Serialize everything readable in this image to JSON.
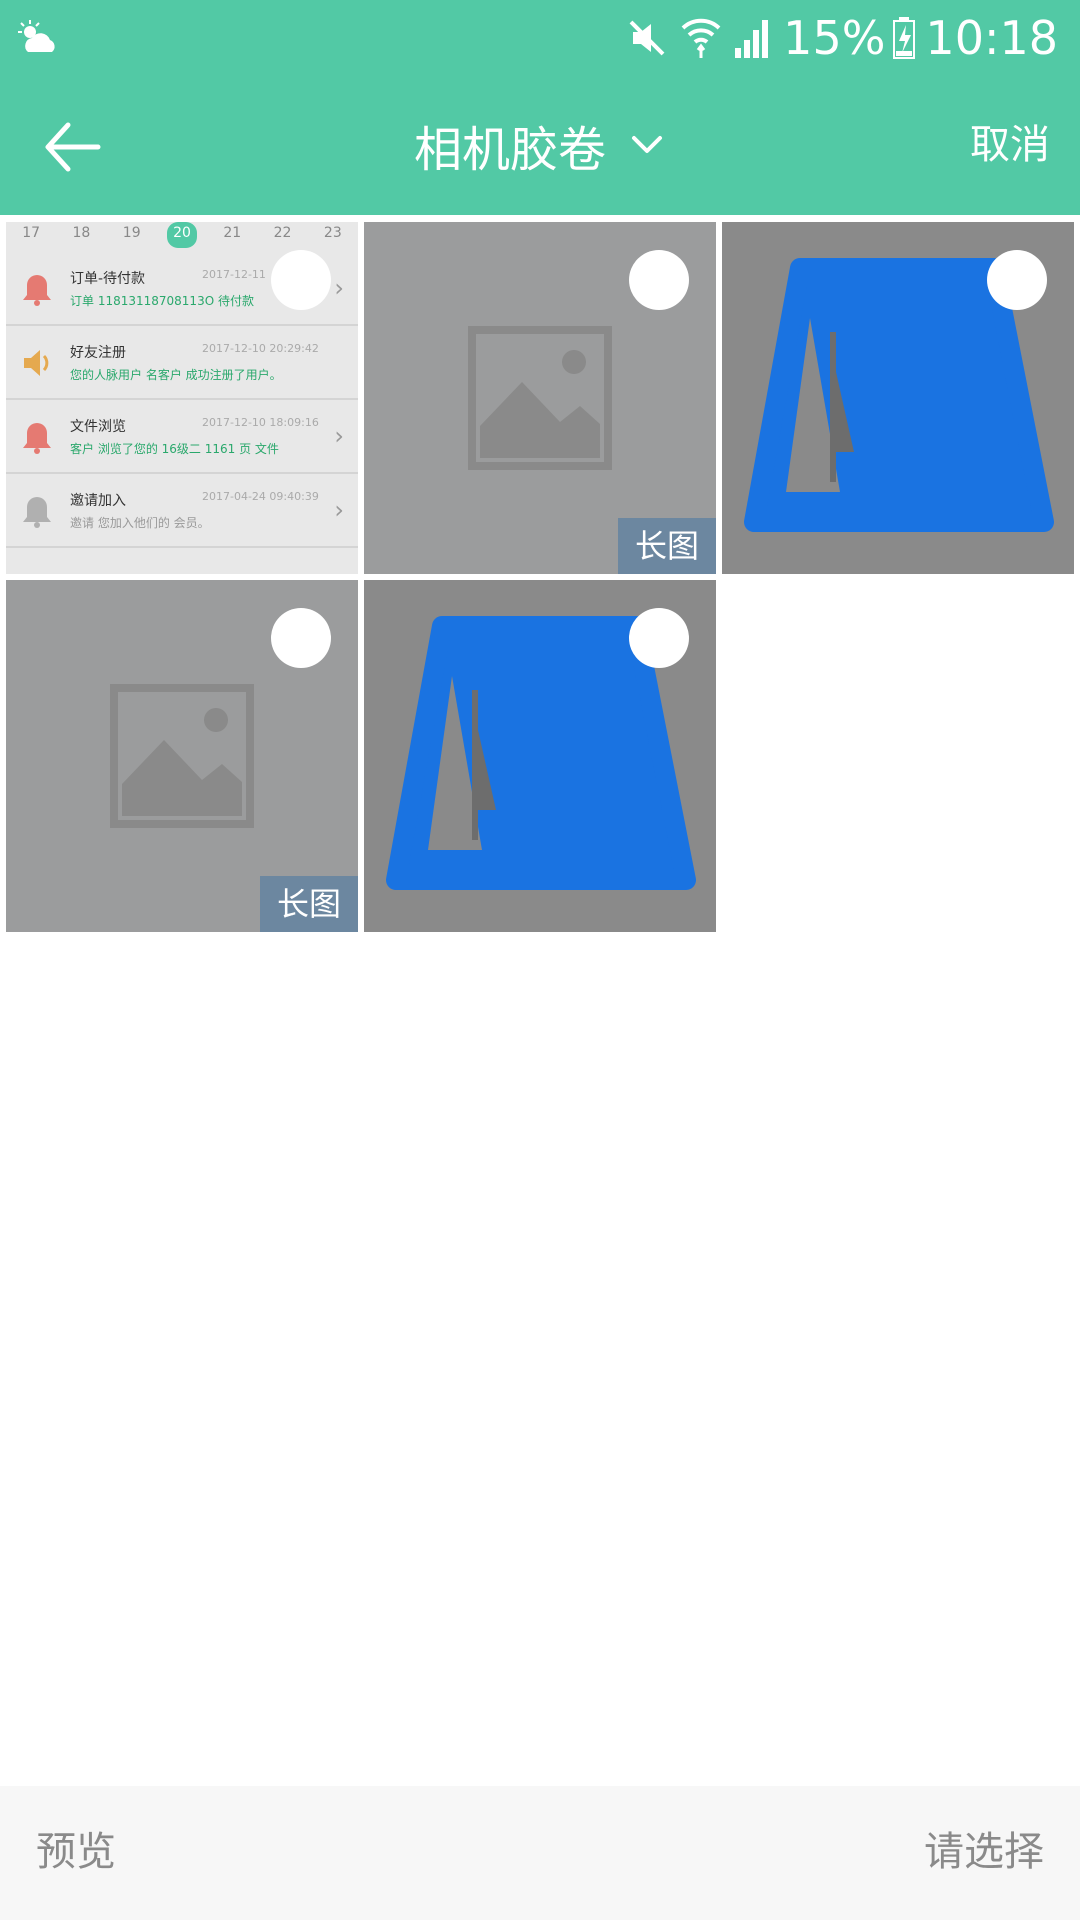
{
  "status_bar": {
    "battery": "15%",
    "time": "10:18",
    "icons": [
      "weather-icon",
      "mute-icon",
      "wifi-icon",
      "signal-icon",
      "battery-charging-icon"
    ]
  },
  "app_bar": {
    "title": "相机胶卷",
    "cancel_label": "取消",
    "accent_color": "#52c9a5"
  },
  "grid": {
    "photos": [
      {
        "kind": "notification-screenshot",
        "tag": ""
      },
      {
        "kind": "image-placeholder",
        "tag": "长图"
      },
      {
        "kind": "loading-placeholder",
        "tag": ""
      },
      {
        "kind": "image-placeholder",
        "tag": "长图"
      },
      {
        "kind": "loading-placeholder",
        "tag": ""
      }
    ],
    "notification_thumb": {
      "calendar_days": [
        "17",
        "18",
        "19",
        "20",
        "21",
        "22",
        "23"
      ],
      "active_day": "20",
      "rows": [
        {
          "title": "订单-待付款",
          "time": "2017-12-11",
          "detail": "订单 11813118708113O 待付款",
          "icon": "bell-icon"
        },
        {
          "title": "好友注册",
          "time": "2017-12-10 20:29:42",
          "detail": "您的人脉用户 名客户 成功注册了用户。",
          "icon": "speaker-icon"
        },
        {
          "title": "文件浏览",
          "time": "2017-12-10 18:09:16",
          "detail": "客户 浏览了您的 16级二 1161 页 文件",
          "icon": "bell-icon"
        },
        {
          "title": "邀请加入",
          "time": "2017-04-24 09:40:39",
          "detail": "邀请 您加入他们的 会员。",
          "icon": "bell-icon"
        }
      ]
    }
  },
  "bottom_bar": {
    "preview_label": "预览",
    "select_label": "请选择"
  }
}
